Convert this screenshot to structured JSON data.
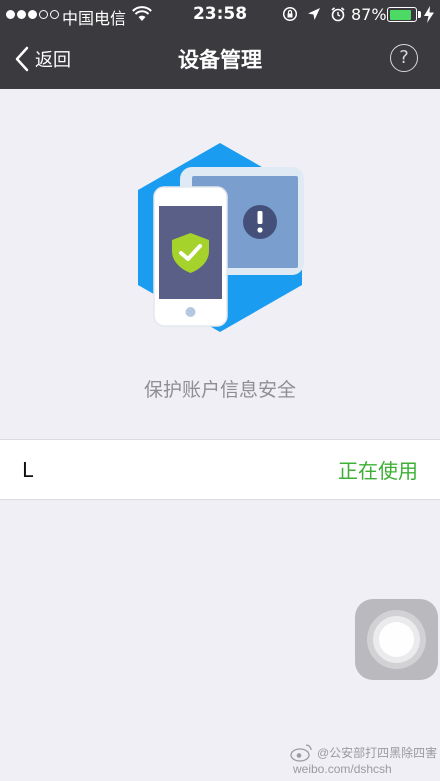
{
  "status_bar": {
    "signal": {
      "filled": 3,
      "total": 5
    },
    "carrier": "中国电信",
    "time": "23:58",
    "battery_percent": "87%",
    "battery_level": 0.87,
    "icons": [
      "wifi-icon",
      "rotation-lock-icon",
      "location-icon",
      "alarm-icon",
      "charging-bolt-icon"
    ]
  },
  "nav": {
    "back_label": "返回",
    "title": "设备管理",
    "help_label": "?"
  },
  "hero": {
    "caption": "保护账户信息安全",
    "illustration_icons": [
      "hexagon-background",
      "tablet-icon",
      "alert-icon",
      "phone-icon",
      "shield-check-icon"
    ]
  },
  "devices": [
    {
      "name": "L",
      "status": "正在使用"
    }
  ],
  "watermark": {
    "line1": "@公安部打四黑除四害",
    "line2": "weibo.com/dshcsh"
  },
  "colors": {
    "header_bg": "#3a3a3f",
    "page_bg": "#f0eff5",
    "status_green": "#3cb034",
    "hex_blue": "#1a9df0",
    "tablet_blue": "#7a9fce",
    "shield_green": "#a6d22c"
  }
}
